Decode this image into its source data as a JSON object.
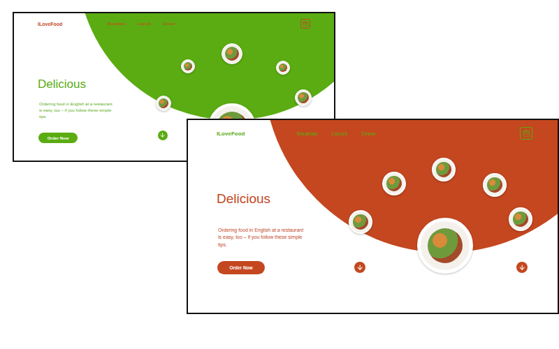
{
  "mockups": [
    {
      "color": "#5aac12",
      "accent": "#c6471f",
      "logo": "ILoveFood",
      "nav": [
        "Breakfast",
        "Launch",
        "Dinner"
      ],
      "heading": "Delicious",
      "text": "Ordering food in English at a restaurant is easy, too – if you follow these simple tips.",
      "button": "Order Now"
    },
    {
      "color": "#c4471f",
      "accent": "#5aac12",
      "logo": "ILoveFood",
      "nav": [
        "Breakfast",
        "Launch",
        "Dinner"
      ],
      "heading": "Delicious",
      "text": "Ordering food in English at a restaurant is easy, too – if you follow these simple tips.",
      "button": "Order Now"
    }
  ]
}
